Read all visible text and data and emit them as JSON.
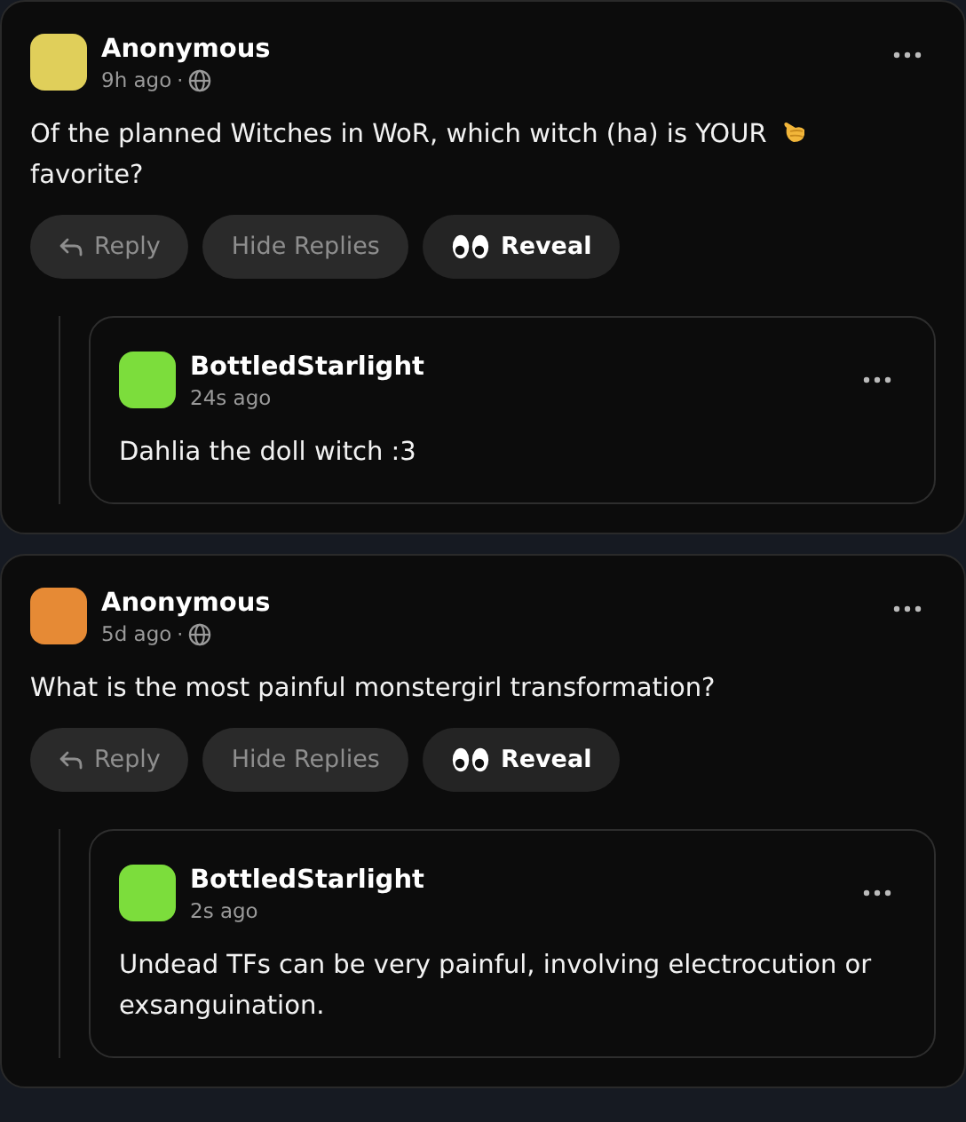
{
  "posts": [
    {
      "author": "Anonymous",
      "color": "#e0cf5a",
      "time": "9h ago",
      "separator": "·",
      "public": true,
      "text": [
        "Of the planned Witches in WoR, which witch (ha) is YOUR",
        "favorite?"
      ],
      "actions": [
        {
          "kind": "reply",
          "label": "Reply"
        },
        {
          "kind": "toggle",
          "label": "Hide Replies"
        },
        {
          "kind": "reveal",
          "label": "Reveal"
        }
      ],
      "replies": [
        {
          "author": "BottledStarlight",
          "color": "#7cdd3c",
          "time": "24s ago",
          "public": false,
          "text": [
            "Dahlia the doll witch :3"
          ]
        }
      ]
    },
    {
      "author": "Anonymous",
      "color": "#e68a35",
      "time": "5d ago",
      "separator": "·",
      "public": true,
      "text": [
        "What is the most painful monstergirl transformation?"
      ],
      "actions": [
        {
          "kind": "reply",
          "label": "Reply"
        },
        {
          "kind": "toggle",
          "label": "Hide Replies"
        },
        {
          "kind": "reveal",
          "label": "Reveal"
        }
      ],
      "replies": [
        {
          "author": "BottledStarlight",
          "color": "#7cdd3c",
          "time": "2s ago",
          "public": false,
          "text": [
            "Undead TFs can be very painful, involving electrocution or exsanguination."
          ]
        }
      ]
    }
  ]
}
